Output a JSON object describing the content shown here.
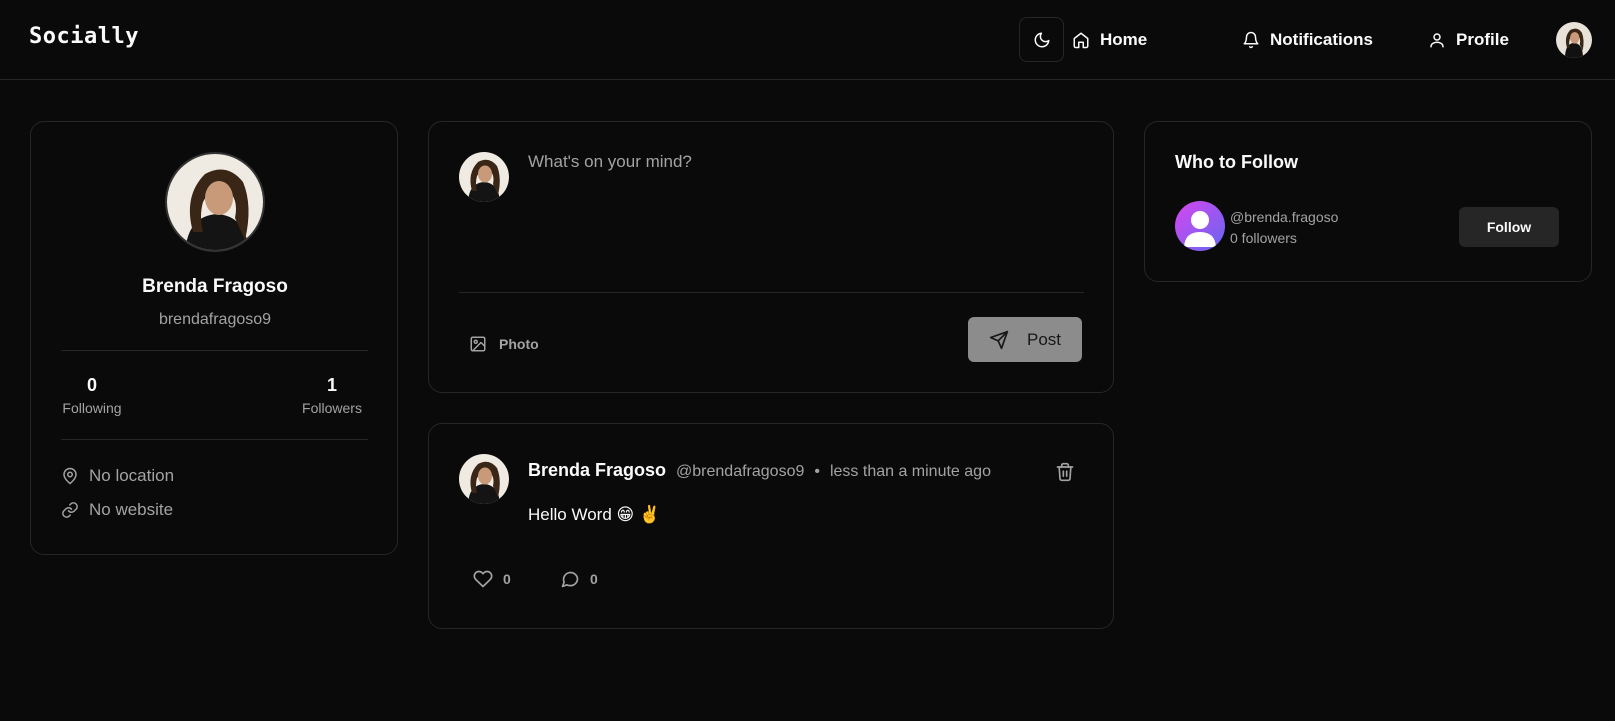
{
  "app": {
    "brand": "Socially"
  },
  "nav": {
    "theme_icon": "moon-icon",
    "items": [
      {
        "label": "Home",
        "icon": "home-icon"
      },
      {
        "label": "Notifications",
        "icon": "bell-icon"
      },
      {
        "label": "Profile",
        "icon": "user-icon"
      }
    ]
  },
  "profile": {
    "name": "Brenda Fragoso",
    "username": "brendafragoso9",
    "following_count": "0",
    "following_label": "Following",
    "followers_count": "1",
    "followers_label": "Followers",
    "location": "No location",
    "website": "No website"
  },
  "composer": {
    "placeholder": "What's on your mind?",
    "photo_label": "Photo",
    "post_label": "Post"
  },
  "post": {
    "author": "Brenda Fragoso",
    "handle": "@brendafragoso9",
    "separator": "•",
    "time": "less than a minute ago",
    "content": "Hello Word 😁 ✌️",
    "likes": "0",
    "comments": "0"
  },
  "who_to_follow": {
    "title": "Who to Follow",
    "suggestions": [
      {
        "handle": "@brenda.fragoso",
        "followers": "0 followers",
        "button": "Follow"
      }
    ]
  },
  "colors": {
    "background": "#0a0a0a",
    "border": "#262626",
    "muted_text": "#a3a3a3",
    "post_button": "#8c8c8c"
  }
}
